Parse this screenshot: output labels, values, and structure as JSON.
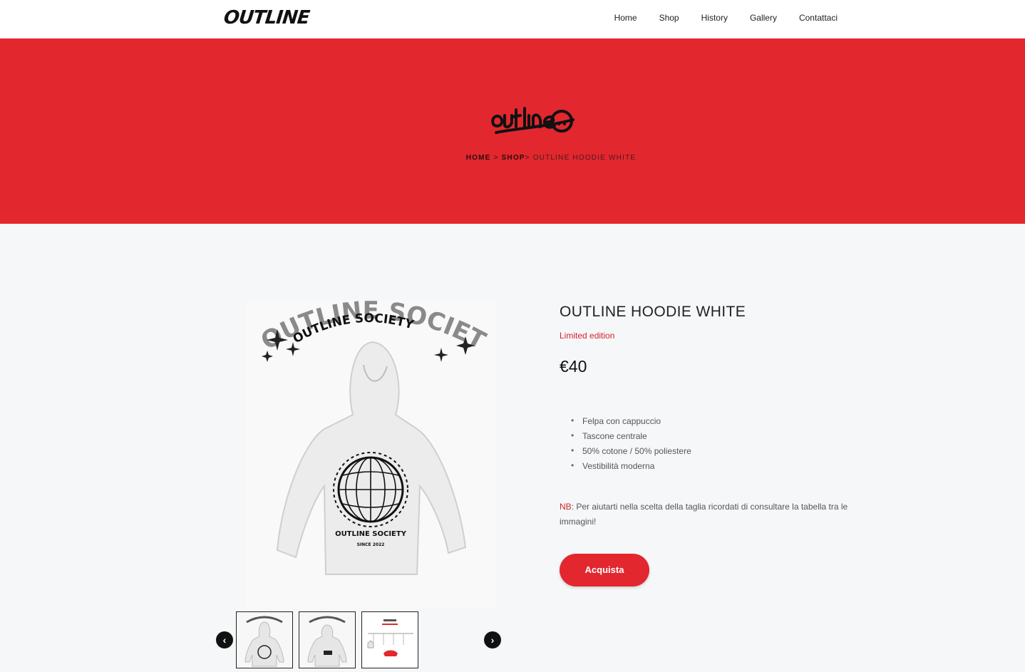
{
  "header": {
    "brand": "OUTLINE",
    "nav": [
      "Home",
      "Shop",
      "History",
      "Gallery",
      "Contattaci"
    ]
  },
  "hero": {
    "breadcrumb_home": "HOME",
    "breadcrumb_sep1": " > ",
    "breadcrumb_shop": "SHOP",
    "breadcrumb_sep2": "> ",
    "breadcrumb_current": "OUTLINE HOODIE WHITE",
    "bg_color": "#e2272e"
  },
  "product": {
    "title": "OUTLINE HOODIE WHITE",
    "edition": "Limited edition",
    "price": "€40",
    "features": [
      "Felpa con cappuccio",
      "Tascone centrale",
      "50% cotone / 50% poliestere",
      "Vestibilità moderna"
    ],
    "note_label": "NB",
    "note_text": ": Per aiutarti nella scelta della taglia ricordati di consultare la tabella tra le immagini!",
    "buy_label": "Acquista",
    "image_text": "OUTLINE SOCIETY",
    "image_subtext": "SINCE 2022"
  },
  "gallery": {
    "prev_icon": "chevron-left-icon",
    "next_icon": "chevron-right-icon",
    "thumbs": [
      "hoodie-back",
      "hoodie-front",
      "size-chart"
    ]
  }
}
